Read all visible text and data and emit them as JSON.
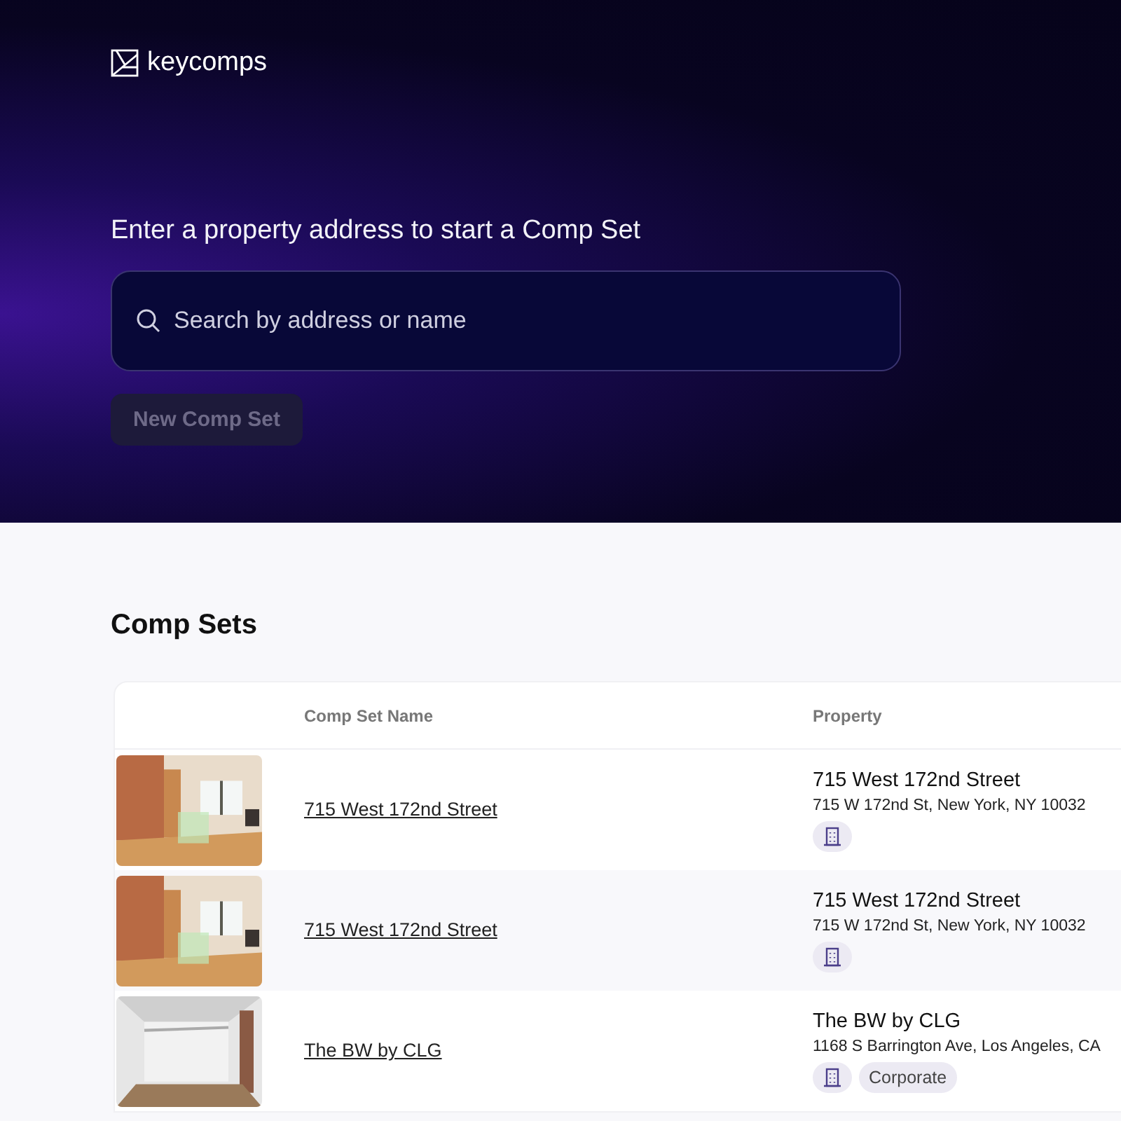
{
  "brand": {
    "name": "keycomps"
  },
  "hero": {
    "heading": "Enter a property address to start a Comp Set",
    "search": {
      "placeholder": "Search by address or name"
    },
    "button": {
      "label": "New Comp Set",
      "disabled": true
    }
  },
  "comp_sets": {
    "title": "Comp Sets",
    "columns": [
      "Comp Set Name",
      "Property"
    ],
    "rows": [
      {
        "name": "715 West 172nd Street",
        "property": "715 West 172nd Street",
        "address": "715 W 172nd St, New York, NY 10032",
        "tags": [
          {
            "kind": "building"
          }
        ]
      },
      {
        "name": "715 West 172nd Street",
        "property": "715 West 172nd Street",
        "address": "715 W 172nd St, New York, NY 10032",
        "tags": [
          {
            "kind": "building"
          }
        ]
      },
      {
        "name": "The BW by CLG",
        "property": "The BW by CLG",
        "address": "1168 S Barrington Ave, Los Angeles, CA",
        "tags": [
          {
            "kind": "building"
          },
          {
            "kind": "label",
            "label": "Corporate"
          }
        ]
      }
    ]
  }
}
